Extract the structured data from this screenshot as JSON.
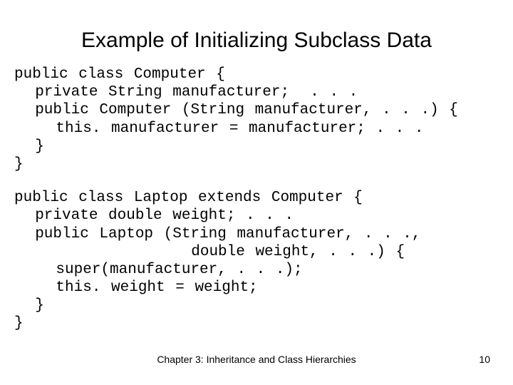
{
  "title": "Example of Initializing Subclass Data",
  "code": {
    "block1": "public class Computer {\n  private String manufacturer;  . . .\n  public Computer (String manufacturer, . . .) {\n    this. manufacturer = manufacturer; . . .\n  }\n}",
    "block2": "public class Laptop extends Computer {\n  private double weight; . . .\n  public Laptop (String manufacturer, . . .,\n                 double weight, . . .) {\n    super(manufacturer, . . .);\n    this. weight = weight;\n  }\n}"
  },
  "footer": {
    "text": "Chapter 3: Inheritance and Class Hierarchies",
    "page": "10"
  }
}
